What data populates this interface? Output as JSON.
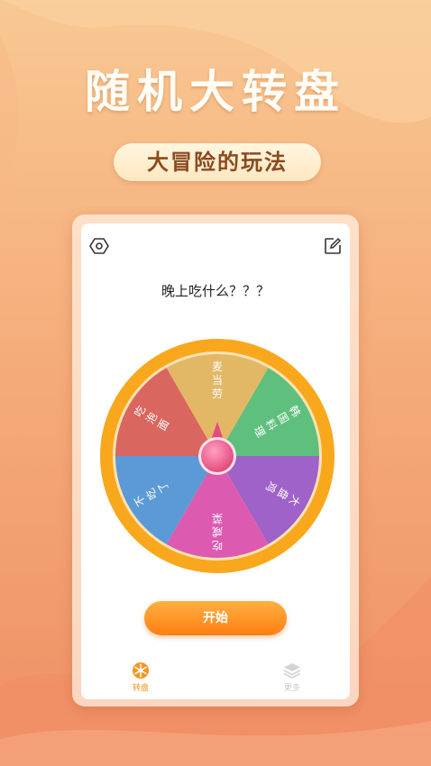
{
  "header": {
    "title": "随机大转盘",
    "subtitle": "大冒险的玩法"
  },
  "card": {
    "settings_icon": "hexagon-settings-icon",
    "edit_icon": "pencil-edit-icon",
    "question": "晚上吃什么？？？"
  },
  "wheel": {
    "rim_color": "#f9a81d",
    "slices": [
      {
        "label": "麦当劳",
        "color": "#e2b867"
      },
      {
        "label": "韩国料理",
        "color": "#5fbf7d"
      },
      {
        "label": "大盘鸡",
        "color": "#9f62c9"
      },
      {
        "label": "吃咸菜",
        "color": "#dc5bb1"
      },
      {
        "label": "不吃了",
        "color": "#5b9ad6"
      },
      {
        "label": "吃泡面",
        "color": "#da6660"
      }
    ]
  },
  "start_button": {
    "label": "开始"
  },
  "tabbar": {
    "items": [
      {
        "label": "转盘",
        "icon": "wheel-icon",
        "active": true
      },
      {
        "label": "更多",
        "icon": "layers-icon",
        "active": false
      }
    ]
  }
}
